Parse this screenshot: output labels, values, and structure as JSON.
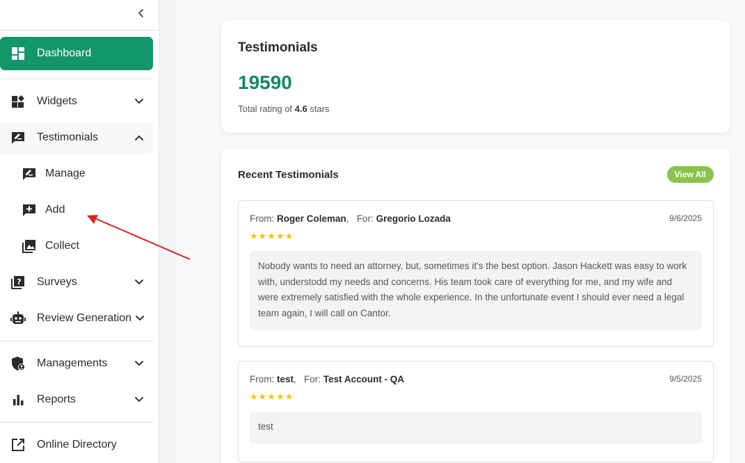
{
  "sidebar": {
    "items": [
      {
        "label": "Dashboard",
        "icon": "dashboard-icon"
      },
      {
        "label": "Widgets",
        "icon": "widgets-icon"
      },
      {
        "label": "Testimonials",
        "icon": "testimonials-icon"
      },
      {
        "label": "Surveys",
        "icon": "surveys-icon"
      },
      {
        "label": "Review Generation",
        "icon": "robot-icon"
      },
      {
        "label": "Managements",
        "icon": "shield-user-icon"
      },
      {
        "label": "Reports",
        "icon": "bar-chart-icon"
      },
      {
        "label": "Online Directory",
        "icon": "external-link-icon"
      }
    ],
    "testimonials_sub": [
      {
        "label": "Manage",
        "icon": "edit-comment-icon"
      },
      {
        "label": "Add",
        "icon": "add-comment-icon"
      },
      {
        "label": "Collect",
        "icon": "photo-library-icon"
      }
    ]
  },
  "summary": {
    "title": "Testimonials",
    "count": "19590",
    "rating_prefix": "Total rating of",
    "rating_value": "4.6",
    "rating_suffix": "stars"
  },
  "recent": {
    "title": "Recent Testimonials",
    "view_all": "View All",
    "items": [
      {
        "from_label": "From:",
        "from": "Roger Coleman",
        "for_label": "For:",
        "for": "Gregorio Lozada",
        "date": "9/6/2025",
        "stars": "★★★★★",
        "rating": 5,
        "text": "Nobody wants to need an attorney, but, sometimes it's the best option. Jason Hackett was easy to work with, understodd my needs and concerns. His team took care of everything for me, and my wife and were extremely satisfied with the whole experience. In the unfortunate event I should ever need a legal team again, I will call on Cantor."
      },
      {
        "from_label": "From:",
        "from": "test",
        "for_label": "For:",
        "for": "Test Account - QA",
        "date": "9/5/2025",
        "stars": "★★★★★",
        "rating": 5,
        "text": "test"
      }
    ]
  },
  "colors": {
    "accent": "#12966a",
    "count": "#138a62",
    "view_all": "#8bc34a",
    "stars": "#f3c200",
    "annotation_arrow": "#e02020"
  }
}
